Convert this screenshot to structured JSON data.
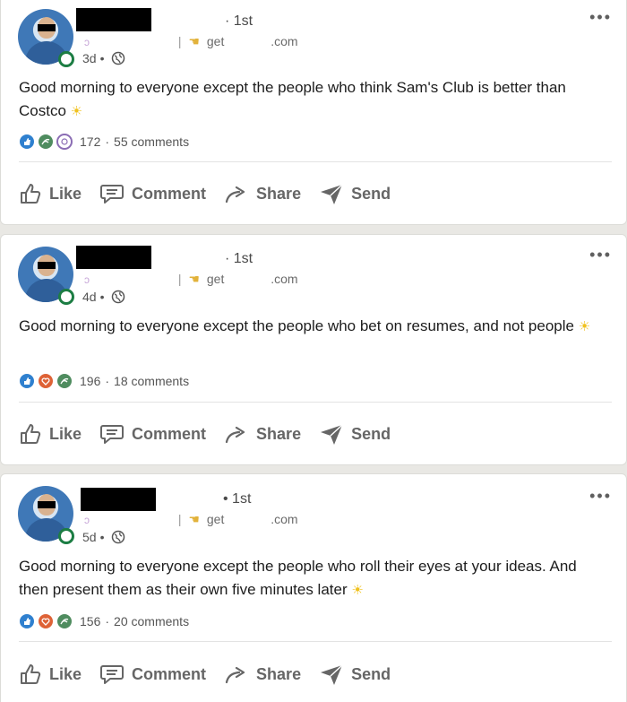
{
  "posts": [
    {
      "degree": "1st",
      "headline": {
        "get": "get",
        "com": ".com"
      },
      "age": "3d",
      "text": "Good morning to everyone except the people who think Sam's Club is better than Costco",
      "reaction_icons": [
        "like",
        "support",
        "curious"
      ],
      "reaction_count": "172",
      "comments": "55 comments"
    },
    {
      "degree": "1st",
      "headline": {
        "get": "get",
        "com": ".com"
      },
      "age": "4d",
      "text": "Good morning to everyone except the people who bet on resumes, and not people",
      "reaction_icons": [
        "like",
        "love",
        "support"
      ],
      "reaction_count": "196",
      "comments": "18 comments"
    },
    {
      "degree": "1st",
      "headline": {
        "get": "get",
        "com": ".com"
      },
      "age": "5d",
      "text": "Good morning to everyone except the people who roll their eyes at your ideas. And then present them as their own five minutes later",
      "reaction_icons": [
        "like",
        "love",
        "support"
      ],
      "reaction_count": "156",
      "comments": "20 comments"
    }
  ],
  "actions": {
    "like": "Like",
    "comment": "Comment",
    "share": "Share",
    "send": "Send"
  },
  "colors": {
    "like": "#2f80cf",
    "love": "#de6236",
    "support": "#4f8c5f",
    "online": "#1c7d43"
  }
}
